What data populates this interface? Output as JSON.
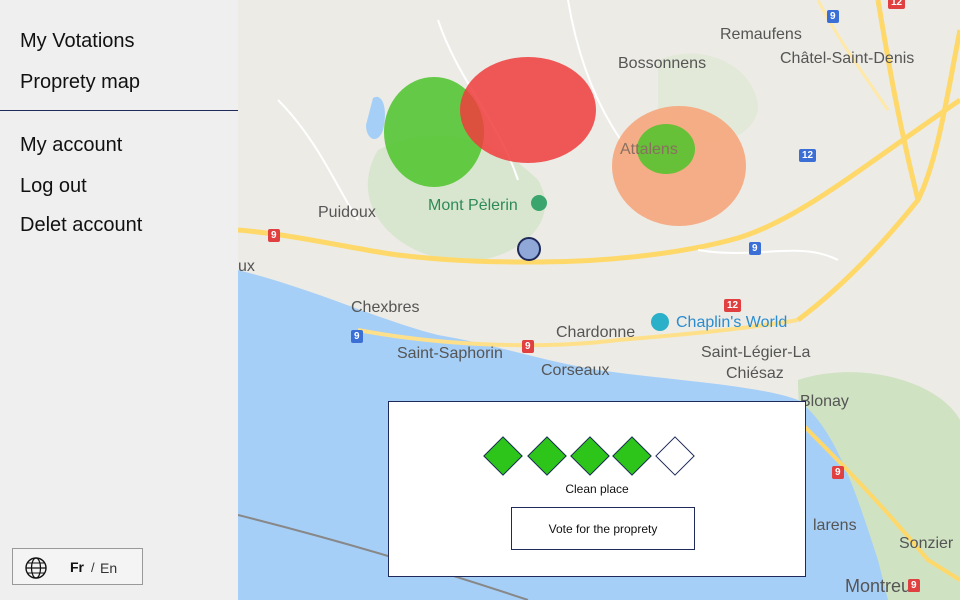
{
  "sidebar": {
    "items": [
      {
        "label": "My Votations"
      },
      {
        "label": "Proprety map"
      },
      {
        "label": "My account"
      },
      {
        "label": "Log out"
      },
      {
        "label": "Delet account"
      }
    ],
    "language": {
      "active": "Fr",
      "separator": "/",
      "other": "En",
      "icon": "globe-icon"
    }
  },
  "map": {
    "places": {
      "remaufens": "Remaufens",
      "chatel": "Châtel-Saint-Denis",
      "bossonnens": "Bossonnens",
      "attalens": "Attalens",
      "puidoux": "Puidoux",
      "mont_pelerin": "Mont Pèlerin",
      "chexbres": "Chexbres",
      "chardonne": "Chardonne",
      "chaplin": "Chaplin's World",
      "saint_saphorin": "Saint-Saphorin",
      "corseaux": "Corseaux",
      "saint_legier_1": "Saint-Légier-La",
      "saint_legier_2": "Chiésaz",
      "blonay": "Blonay",
      "clarens": "larens",
      "sonzier": "Sonzier",
      "montreux": "Montreux",
      "ux": "ux"
    },
    "roads": {
      "r9": "9",
      "r12": "12"
    },
    "zone_colors": {
      "green": "#4cc32a",
      "red": "#f03c3c",
      "orange": "#f7a275"
    }
  },
  "popup": {
    "rating": {
      "value": 4,
      "max": 5
    },
    "rating_label": "Clean place",
    "vote_label": "Vote for the proprety",
    "colors": {
      "filled": "#2ec51a",
      "border": "#1f2a5a"
    }
  }
}
